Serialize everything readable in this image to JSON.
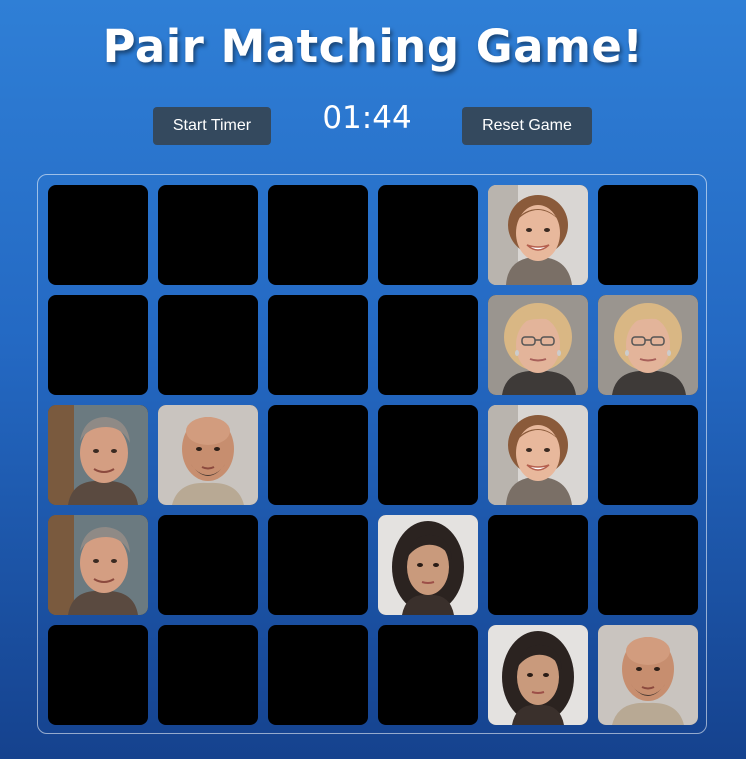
{
  "title": "Pair Matching Game!",
  "controls": {
    "start_label": "Start Timer",
    "reset_label": "Reset Game",
    "timer": "01:44"
  },
  "board": {
    "rows": 5,
    "cols": 6,
    "cards": [
      {
        "r": 0,
        "c": 0,
        "state": "hidden"
      },
      {
        "r": 0,
        "c": 1,
        "state": "hidden"
      },
      {
        "r": 0,
        "c": 2,
        "state": "hidden"
      },
      {
        "r": 0,
        "c": 3,
        "state": "hidden"
      },
      {
        "r": 0,
        "c": 4,
        "state": "revealed",
        "face": "smiling-woman-face"
      },
      {
        "r": 0,
        "c": 5,
        "state": "hidden"
      },
      {
        "r": 1,
        "c": 0,
        "state": "hidden"
      },
      {
        "r": 1,
        "c": 1,
        "state": "hidden"
      },
      {
        "r": 1,
        "c": 2,
        "state": "hidden"
      },
      {
        "r": 1,
        "c": 3,
        "state": "hidden"
      },
      {
        "r": 1,
        "c": 4,
        "state": "revealed",
        "face": "older-woman-glasses-face"
      },
      {
        "r": 1,
        "c": 5,
        "state": "revealed",
        "face": "older-woman-glasses-face"
      },
      {
        "r": 2,
        "c": 0,
        "state": "revealed",
        "face": "older-man-face"
      },
      {
        "r": 2,
        "c": 1,
        "state": "revealed",
        "face": "bald-man-face"
      },
      {
        "r": 2,
        "c": 2,
        "state": "hidden"
      },
      {
        "r": 2,
        "c": 3,
        "state": "hidden"
      },
      {
        "r": 2,
        "c": 4,
        "state": "revealed",
        "face": "smiling-woman-face"
      },
      {
        "r": 2,
        "c": 5,
        "state": "hidden"
      },
      {
        "r": 3,
        "c": 0,
        "state": "revealed",
        "face": "older-man-face"
      },
      {
        "r": 3,
        "c": 1,
        "state": "hidden"
      },
      {
        "r": 3,
        "c": 2,
        "state": "hidden"
      },
      {
        "r": 3,
        "c": 3,
        "state": "revealed",
        "face": "dark-haired-woman-face"
      },
      {
        "r": 3,
        "c": 4,
        "state": "hidden"
      },
      {
        "r": 3,
        "c": 5,
        "state": "hidden"
      },
      {
        "r": 4,
        "c": 0,
        "state": "hidden"
      },
      {
        "r": 4,
        "c": 1,
        "state": "hidden"
      },
      {
        "r": 4,
        "c": 2,
        "state": "hidden"
      },
      {
        "r": 4,
        "c": 3,
        "state": "hidden"
      },
      {
        "r": 4,
        "c": 4,
        "state": "revealed",
        "face": "dark-haired-woman-face"
      },
      {
        "r": 4,
        "c": 5,
        "state": "revealed",
        "face": "bald-man-face"
      }
    ]
  },
  "colors": {
    "card_back": "#000000",
    "button_bg": "#34495e"
  }
}
